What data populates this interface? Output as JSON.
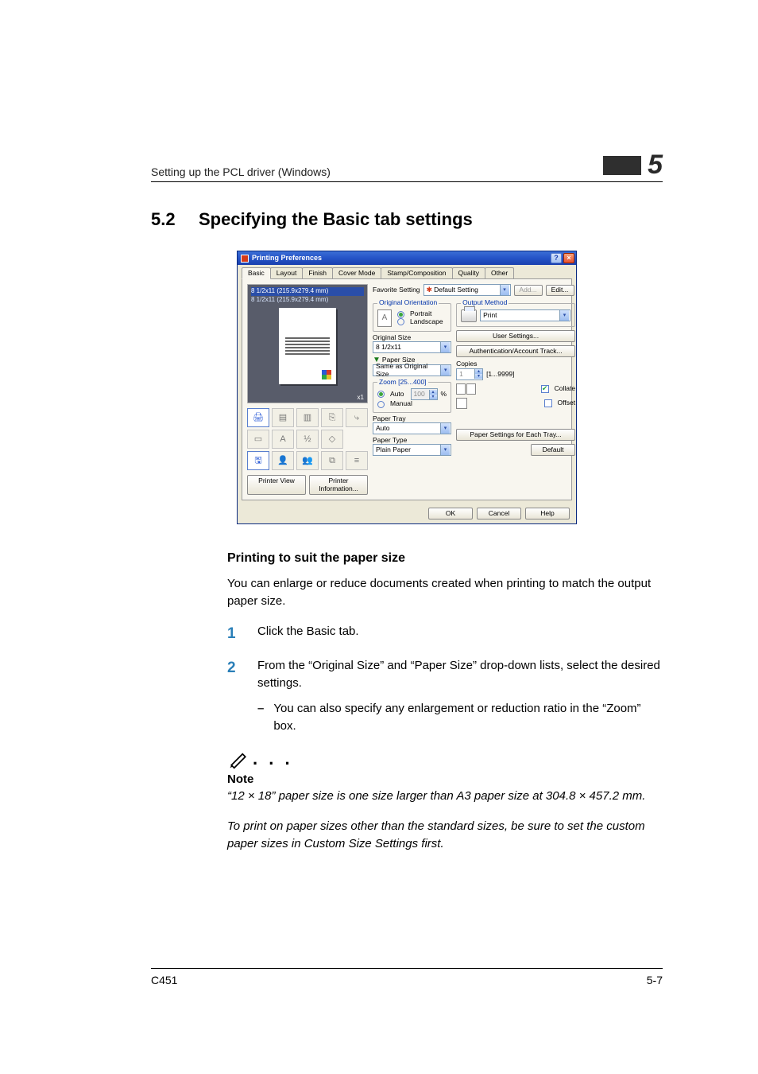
{
  "header": {
    "left": "Setting up the PCL driver (Windows)",
    "chapter": "5"
  },
  "section": {
    "number": "5.2",
    "title": "Specifying the Basic tab settings"
  },
  "dialog": {
    "title": "Printing Preferences",
    "tabs": [
      "Basic",
      "Layout",
      "Finish",
      "Cover Mode",
      "Stamp/Composition",
      "Quality",
      "Other"
    ],
    "active_tab": 0,
    "favorite": {
      "label": "Favorite Setting",
      "value": "Default Setting",
      "add": "Add...",
      "edit": "Edit..."
    },
    "preview": {
      "line1": "8 1/2x11 (215.9x279.4 mm)",
      "line2": "8 1/2x11 (215.9x279.4 mm)",
      "scale": "x1"
    },
    "left_buttons": {
      "printer_view": "Printer View",
      "printer_info": "Printer Information..."
    },
    "orientation": {
      "legend": "Original Orientation",
      "portrait": "Portrait",
      "landscape": "Landscape",
      "selected": "portrait"
    },
    "original_size": {
      "label": "Original Size",
      "value": "8 1/2x11"
    },
    "paper_size": {
      "label": "Paper Size",
      "value": "Same as Original Size"
    },
    "zoom": {
      "legend": "Zoom [25...400]",
      "auto": "Auto",
      "manual": "Manual",
      "selected": "auto",
      "value": "100",
      "suffix": "%"
    },
    "paper_tray": {
      "label": "Paper Tray",
      "value": "Auto"
    },
    "paper_type": {
      "label": "Paper Type",
      "value": "Plain Paper"
    },
    "output_method": {
      "legend": "Output Method",
      "value": "Print"
    },
    "user_settings": "User Settings...",
    "auth_track": "Authentication/Account Track...",
    "copies": {
      "label": "Copies",
      "value": "1",
      "range": "[1...9999]"
    },
    "collate": {
      "label": "Collate",
      "checked": true
    },
    "offset": {
      "label": "Offset",
      "checked": false
    },
    "paper_settings_each_tray": "Paper Settings for Each Tray...",
    "default_btn": "Default",
    "ok": "OK",
    "cancel": "Cancel",
    "help": "Help"
  },
  "body": {
    "subhead": "Printing to suit the paper size",
    "intro": "You can enlarge or reduce documents created when printing to match the output paper size.",
    "steps": [
      {
        "n": "1",
        "text": "Click the Basic tab."
      },
      {
        "n": "2",
        "text": "From the “Original Size” and “Paper Size” drop-down lists, select the desired settings.",
        "sub": "You can also specify any enlargement or reduction ratio in the “Zoom” box."
      }
    ],
    "note": {
      "label": "Note",
      "p1": "“12 × 18” paper size is one size larger than A3 paper size at 304.8 × 457.2 mm.",
      "p2": "To print on paper sizes other than the standard sizes, be sure to set the custom paper sizes in Custom Size Settings first."
    }
  },
  "footer": {
    "left": "C451",
    "right": "5-7"
  }
}
